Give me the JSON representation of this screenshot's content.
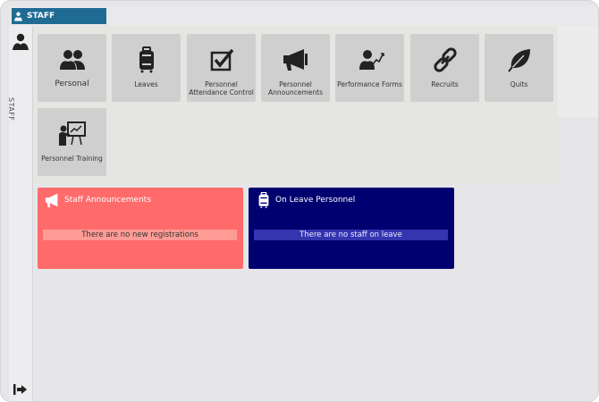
{
  "header": {
    "tab_label": "STAFF",
    "tab_color": "#1f6b94"
  },
  "sidebar": {
    "vertical_label": "STAFF",
    "icons": [
      "person-icon",
      "logout-icon"
    ]
  },
  "tiles": [
    {
      "key": "personal",
      "label": "Personal",
      "icon": "users-icon"
    },
    {
      "key": "leaves",
      "label": "Leaves",
      "icon": "luggage-icon"
    },
    {
      "key": "attendance",
      "label": "Personnel Attendance Control",
      "icon": "checkbox-icon"
    },
    {
      "key": "announcements",
      "label": "Personnel Announcements",
      "icon": "megaphone-icon"
    },
    {
      "key": "performance",
      "label": "Performance Forms",
      "icon": "performance-icon"
    },
    {
      "key": "recruits",
      "label": "Recruits",
      "icon": "link-icon"
    },
    {
      "key": "quits",
      "label": "Quits",
      "icon": "leaf-icon"
    },
    {
      "key": "training",
      "label": "Personnel Training",
      "icon": "presentation-icon"
    }
  ],
  "cards": {
    "announcements": {
      "title": "Staff Announcements",
      "message": "There are no new registrations",
      "color": "#ff6b6b",
      "icon": "megaphone-icon"
    },
    "on_leave": {
      "title": "On Leave Personnel",
      "message": "There are no staff on leave",
      "color": "#000070",
      "icon": "luggage-icon"
    }
  }
}
